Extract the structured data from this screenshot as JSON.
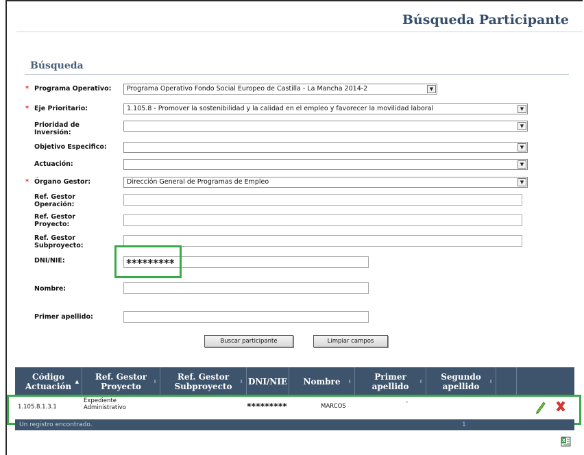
{
  "header": {
    "title": "Búsqueda Participante"
  },
  "search": {
    "title": "Búsqueda",
    "fields": {
      "programa_label": "Programa Operativo:",
      "programa_value": "Programa Operativo Fondo Social Europeo de Castilla - La Mancha 2014-2",
      "eje_label": "Eje Prioritario:",
      "eje_value": "1.105.8 - Promover la sostenibilidad y la calidad en el empleo y favorecer la movilidad laboral",
      "prioridad_label": "Prioridad de Inversión:",
      "objetivo_label": "Objetivo Especifico:",
      "actuacion_label": "Actuación:",
      "organo_label": "Órgano Gestor:",
      "organo_value": "Dirección General de Programas de Empleo",
      "ref_operacion_label": "Ref. Gestor Operación:",
      "ref_proyecto_label": "Ref. Gestor Proyecto:",
      "ref_subproyecto_label": "Ref. Gestor Subproyecto:",
      "dni_label": "DNI/NIE:",
      "dni_value": "*********",
      "nombre_label": "Nombre:",
      "apellido_label": "Primer apellido:"
    },
    "buttons": {
      "search": "Buscar participante",
      "clear": "Limpiar campos"
    }
  },
  "grid": {
    "columns": [
      "Código Actuación",
      "Ref. Gestor Proyecto",
      "Ref. Gestor Subproyecto",
      "DNI/NIE",
      "Nombre",
      "Primer apellido",
      "Segundo apellido"
    ],
    "rows": [
      {
        "codigo": "1.105.8.1.3.1",
        "proyecto": "Expediente Administrativo",
        "subproyecto": "",
        "dni": "*********",
        "nombre": "MARCOS",
        "primer_apellido": "-",
        "segundo_apellido": ""
      }
    ],
    "footer_text": "Un registro encontrado.",
    "page_number": "1"
  },
  "icons": {
    "edit": "pencil-icon",
    "delete": "delete-x-icon",
    "export": "excel-export-icon"
  },
  "colors": {
    "header_bg": "#3e546c",
    "highlight": "#3aa94a",
    "required": "#e0262a",
    "title": "#354e6b"
  }
}
